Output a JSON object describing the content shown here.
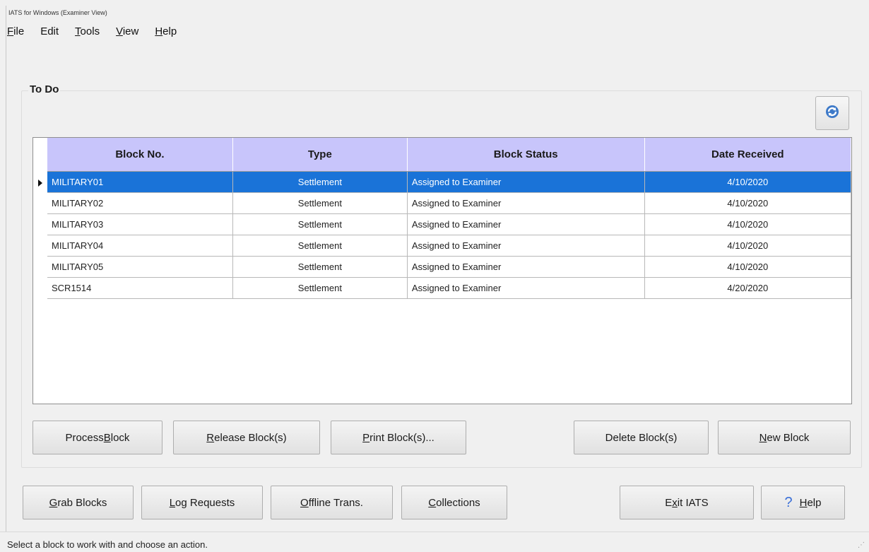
{
  "window": {
    "title": "IATS for Windows (Examiner View)"
  },
  "menu": [
    {
      "label": "File",
      "mnemonic": "F",
      "rest": "ile"
    },
    {
      "label": "Edit",
      "mnemonic": "",
      "rest": "Edit"
    },
    {
      "label": "Tools",
      "mnemonic": "T",
      "rest": "ools"
    },
    {
      "label": "View",
      "mnemonic": "V",
      "rest": "iew"
    },
    {
      "label": "Help",
      "mnemonic": "H",
      "rest": "elp"
    }
  ],
  "todo": {
    "group_label": "To Do",
    "refresh_icon": "refresh-icon",
    "columns": [
      "Block No.",
      "Type",
      "Block Status",
      "Date Received"
    ],
    "rows": [
      {
        "block_no": "MILITARY01",
        "type": "Settlement",
        "status": "Assigned to Examiner",
        "date": "4/10/2020",
        "selected": true
      },
      {
        "block_no": "MILITARY02",
        "type": "Settlement",
        "status": "Assigned to Examiner",
        "date": "4/10/2020",
        "selected": false
      },
      {
        "block_no": "MILITARY03",
        "type": "Settlement",
        "status": "Assigned to Examiner",
        "date": "4/10/2020",
        "selected": false
      },
      {
        "block_no": "MILITARY04",
        "type": "Settlement",
        "status": "Assigned to Examiner",
        "date": "4/10/2020",
        "selected": false
      },
      {
        "block_no": "MILITARY05",
        "type": "Settlement",
        "status": "Assigned to Examiner",
        "date": "4/10/2020",
        "selected": false
      },
      {
        "block_no": "SCR1514",
        "type": "Settlement",
        "status": "Assigned to Examiner",
        "date": "4/20/2020",
        "selected": false
      }
    ]
  },
  "block_buttons": {
    "process": {
      "pre": "Process ",
      "mn": "B",
      "post": "lock"
    },
    "release": {
      "pre": "",
      "mn": "R",
      "post": "elease Block(s)"
    },
    "print": {
      "pre": "",
      "mn": "P",
      "post": "rint Block(s)..."
    },
    "delete": {
      "pre": "Delete Block(s)",
      "mn": "",
      "post": ""
    },
    "new": {
      "pre": "",
      "mn": "N",
      "post": "ew Block"
    }
  },
  "bottom_buttons": {
    "grab": {
      "pre": "",
      "mn": "G",
      "post": "rab Blocks"
    },
    "log": {
      "pre": "",
      "mn": "L",
      "post": "og Requests"
    },
    "offline": {
      "pre": "",
      "mn": "O",
      "post": "ffline Trans."
    },
    "collections": {
      "pre": "",
      "mn": "C",
      "post": "ollections"
    },
    "exit": {
      "pre": "E",
      "mn": "x",
      "post": "it IATS"
    },
    "help": {
      "pre": "",
      "mn": "H",
      "post": "elp",
      "icon": "question-icon"
    }
  },
  "status_bar": {
    "text": "Select a block to work with and choose an action."
  },
  "colors": {
    "header": "#c8c5fb",
    "selection": "#1a73d8",
    "help_icon": "#3a6fd8"
  }
}
